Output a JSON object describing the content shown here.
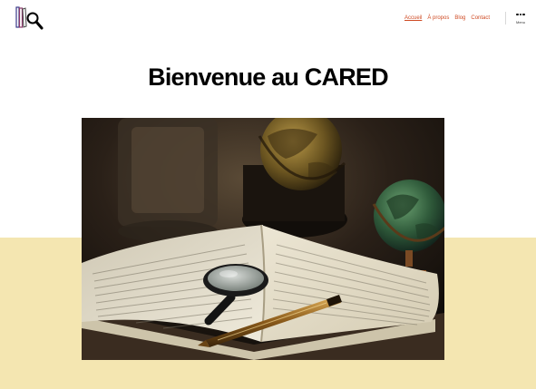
{
  "site": {
    "logo_icon": "magnifier-book-logo-icon"
  },
  "nav": {
    "items": [
      {
        "label": "Accueil",
        "current": true
      },
      {
        "label": "À propos"
      },
      {
        "label": "Blog"
      },
      {
        "label": "Contact"
      }
    ],
    "menu_label": "Menu",
    "menu_icon": "more-dots-icon"
  },
  "page": {
    "title": "Bienvenue au CARED"
  },
  "colors": {
    "accent": "#cf4b24",
    "band": "#f4e6b1",
    "background": "#ffffff"
  },
  "featured_image": {
    "subject": "open book with magnifying glass, fountain pen and globes"
  }
}
